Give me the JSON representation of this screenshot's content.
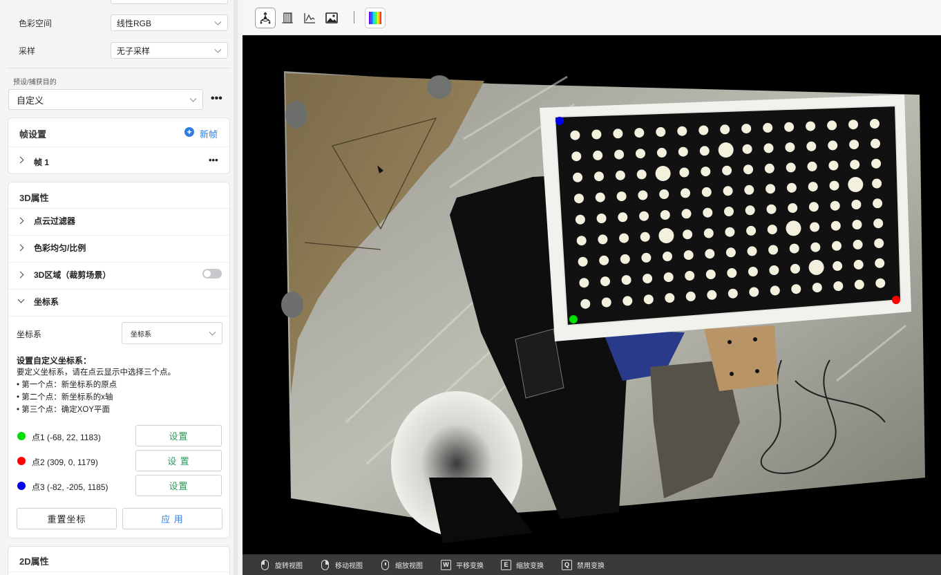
{
  "left_panel": {
    "color_space": {
      "label": "色彩空间",
      "value": "线性RGB"
    },
    "sampling": {
      "label": "采样",
      "value": "无子采样"
    },
    "preset": {
      "label": "预设/捕获目的",
      "value": "自定义"
    },
    "frame_settings": {
      "title": "帧设置",
      "new_frame_label": "新帧",
      "frames": [
        {
          "label": "帧 1"
        }
      ]
    },
    "props3d": {
      "title": "3D属性",
      "items": [
        {
          "label": "点云过滤器"
        },
        {
          "label": "色彩均匀/比例"
        },
        {
          "label": "3D区域（裁剪场景）",
          "toggle": false
        },
        {
          "label": "坐标系"
        }
      ],
      "coord": {
        "label": "坐标系",
        "select_value": "坐标系",
        "heading": "设置自定义坐标系：",
        "desc": "要定义坐标系，请在点云显示中选择三个点。",
        "bullets": [
          "• 第一个点：新坐标系的原点",
          "• 第二个点：新坐标系的x轴",
          "• 第三个点：确定XOY平面"
        ],
        "points": [
          {
            "label": "点1 (-68, 22, 1183)",
            "color": "#00e000",
            "button": "设置"
          },
          {
            "label": "点2 (309, 0, 1179)",
            "color": "#ff0000",
            "button": "设 置"
          },
          {
            "label": "点3 (-82, -205, 1185)",
            "color": "#0000ee",
            "button": "设置"
          }
        ],
        "reset_label": "重置坐标",
        "apply_label": "应 用"
      }
    },
    "props2d": {
      "title": "2D属性"
    }
  },
  "toolbar": {
    "buttons": [
      "point-cloud-view-icon",
      "depth-map-icon",
      "graph-icon",
      "image-icon",
      "colormap-icon"
    ]
  },
  "viewport": {
    "markers": [
      {
        "name": "point-1-marker",
        "color": "#00e000"
      },
      {
        "name": "point-2-marker",
        "color": "#ff0000"
      },
      {
        "name": "point-3-marker",
        "color": "#0000ee"
      }
    ]
  },
  "statusbar": {
    "items": [
      {
        "icon": "mouse-left",
        "label": "旋转视图"
      },
      {
        "icon": "mouse-right",
        "label": "移动视图"
      },
      {
        "icon": "mouse-middle",
        "label": "缩放视图"
      },
      {
        "key": "W",
        "label": "平移变换"
      },
      {
        "key": "E",
        "label": "缩放变换"
      },
      {
        "key": "Q",
        "label": "禁用变换"
      }
    ]
  }
}
